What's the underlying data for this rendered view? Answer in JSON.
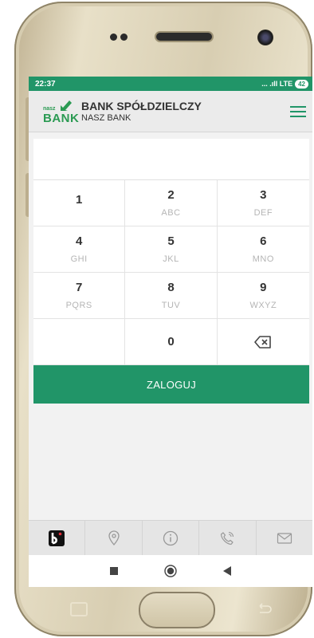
{
  "status_bar": {
    "time": "22:37",
    "signal": "... .ıll LTE",
    "battery": "42"
  },
  "header": {
    "bank_name": "BANK SPÓŁDZIELCZY",
    "bank_subtitle": "NASZ BANK",
    "logo_small": "nasz",
    "logo_big": "BANK"
  },
  "keypad": {
    "keys": [
      {
        "num": "1",
        "letters": ""
      },
      {
        "num": "2",
        "letters": "ABC"
      },
      {
        "num": "3",
        "letters": "DEF"
      },
      {
        "num": "4",
        "letters": "GHI"
      },
      {
        "num": "5",
        "letters": "JKL"
      },
      {
        "num": "6",
        "letters": "MNO"
      },
      {
        "num": "7",
        "letters": "PQRS"
      },
      {
        "num": "8",
        "letters": "TUV"
      },
      {
        "num": "9",
        "letters": "WXYZ"
      },
      {
        "num": "",
        "letters": ""
      },
      {
        "num": "0",
        "letters": ""
      },
      {
        "num": "",
        "letters": ""
      }
    ]
  },
  "login_label": "ZALOGUJ",
  "bottom_nav": [
    "blik-icon",
    "location-pin-icon",
    "info-icon",
    "phone-icon",
    "mail-icon"
  ],
  "colors": {
    "primary": "#219568",
    "background": "#f2f2f2"
  }
}
